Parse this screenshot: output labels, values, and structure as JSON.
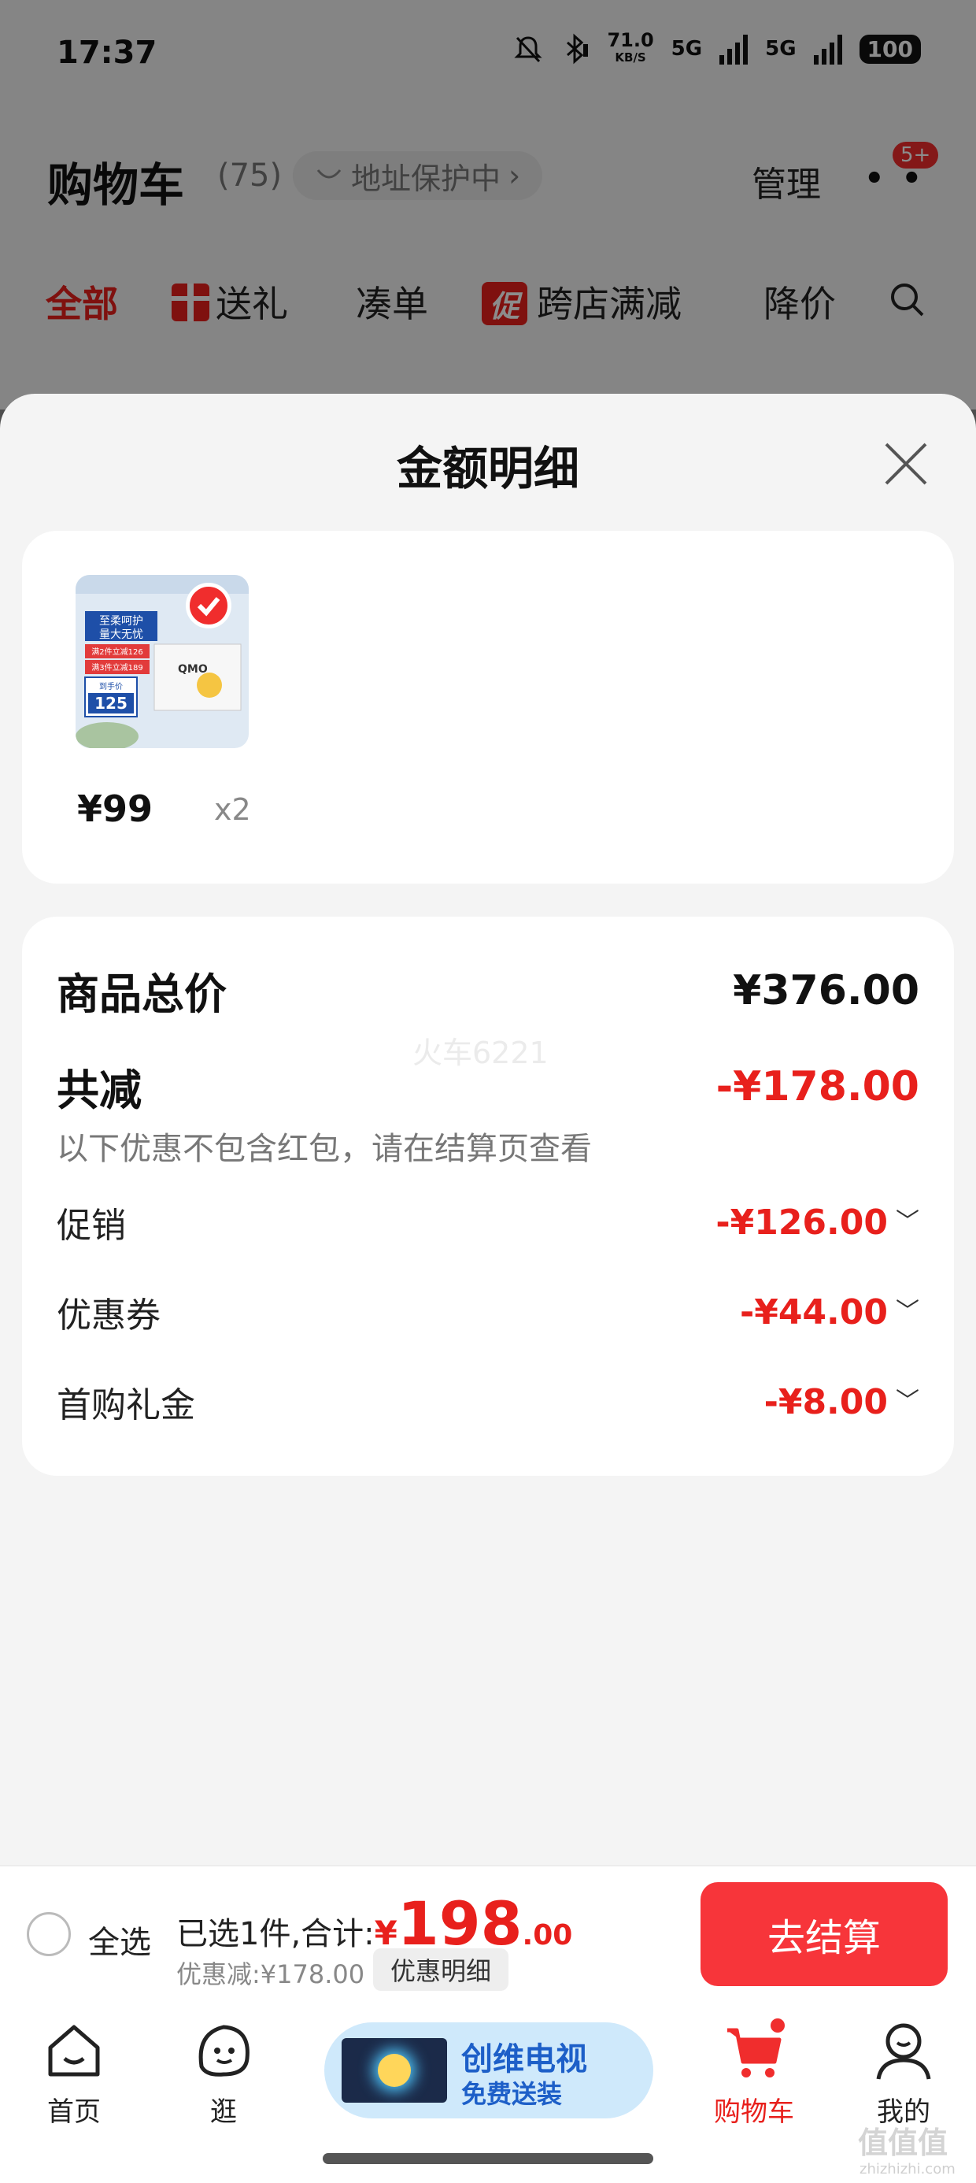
{
  "status_bar": {
    "time": "17:37",
    "net_speed": "71.0",
    "net_unit": "KB/S",
    "sim1": "5G",
    "sim2": "5G",
    "battery": "100"
  },
  "header": {
    "title": "购物车",
    "count": "(75)",
    "address_protection": "地址保护中",
    "manage": "管理",
    "badge": "5+"
  },
  "filter_tabs": [
    {
      "label": "全部",
      "active": true
    },
    {
      "label": "送礼",
      "icon": "gift-icon"
    },
    {
      "label": "凑单"
    },
    {
      "label": "跨店满减",
      "tag": "促"
    },
    {
      "label": "降价"
    }
  ],
  "sheet": {
    "title": "金额明细",
    "product": {
      "price": "¥99",
      "qty": "x2",
      "thumb": {
        "line1": "至柔呵护",
        "line2": "量大无忧",
        "promo1": "满2件立减126",
        "promo2": "满3件立减189",
        "price_label": "到手价",
        "price": "125",
        "brand": "QMO"
      }
    },
    "details": {
      "total_label": "商品总价",
      "total_value": "¥376.00",
      "reduce_label": "共减",
      "reduce_value": "-¥178.00",
      "note": "以下优惠不包含红包，请在结算页查看",
      "watermark": "火车6221",
      "items": [
        {
          "label": "促销",
          "value": "-¥126.00"
        },
        {
          "label": "优惠券",
          "value": "-¥44.00"
        },
        {
          "label": "首购礼金",
          "value": "-¥8.00"
        }
      ]
    }
  },
  "checkout": {
    "select_all": "全选",
    "selected_text": "已选1件,合计:",
    "currency": "¥",
    "amount_int": "198",
    "amount_dec": ".00",
    "discount_text": "优惠减:¥178.00",
    "detail_chip": "优惠明细",
    "checkout_button": "去结算"
  },
  "bottom_nav": {
    "items": [
      {
        "label": "首页",
        "icon": "home-icon"
      },
      {
        "label": "逛",
        "icon": "explore-icon"
      },
      {
        "label": "购物车",
        "icon": "cart-icon",
        "active": true
      },
      {
        "label": "我的",
        "icon": "profile-icon"
      }
    ],
    "ad": {
      "title": "创维电视",
      "subtitle": "免费送装"
    }
  },
  "site_mark": {
    "title": "值值值",
    "sub": "zhizhizhi.com"
  },
  "colors": {
    "accent": "#e8201c",
    "button": "#f7353a",
    "sheet_bg": "#f4f4f4"
  }
}
